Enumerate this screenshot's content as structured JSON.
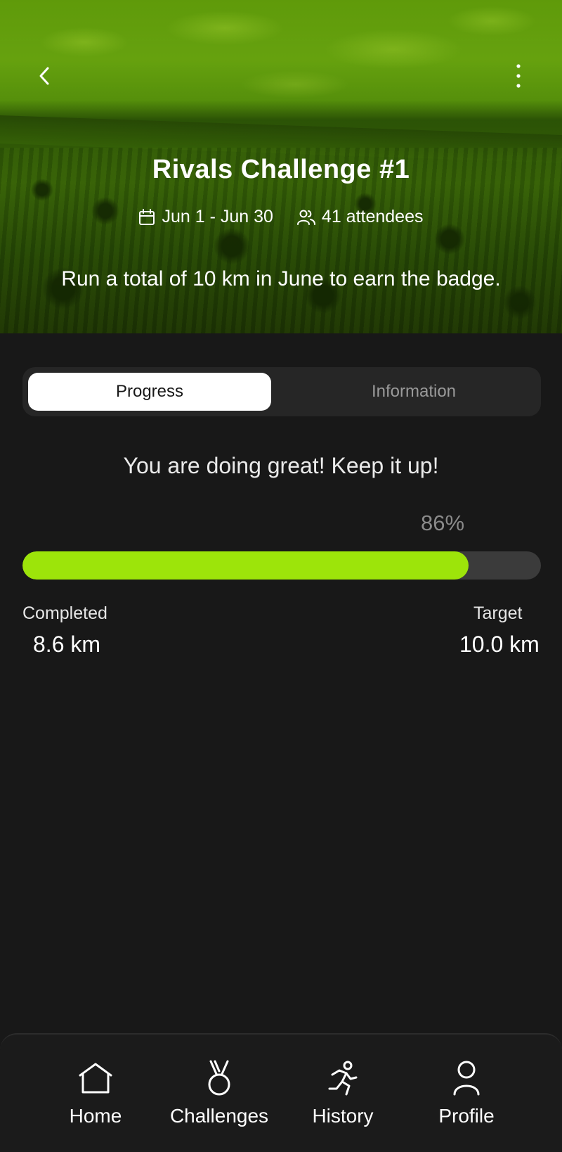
{
  "header": {
    "title": "Rivals Challenge #1",
    "dates": "Jun 1 - Jun 30",
    "attendees": "41 attendees",
    "description": "Run a total of 10 km in June to earn the badge."
  },
  "tabs": [
    {
      "label": "Progress",
      "active": true
    },
    {
      "label": "Information",
      "active": false
    }
  ],
  "progress": {
    "message": "You are doing great! Keep it up!",
    "percent_label": "86%",
    "fraction": 0.86,
    "completed_label": "Completed",
    "completed_value": "8.6 km",
    "target_label": "Target",
    "target_value": "10.0 km"
  },
  "nav": [
    {
      "label": "Home",
      "icon": "home-icon"
    },
    {
      "label": "Challenges",
      "icon": "medal-icon"
    },
    {
      "label": "History",
      "icon": "runner-icon"
    },
    {
      "label": "Profile",
      "icon": "user-icon"
    }
  ],
  "colors": {
    "accent": "#9de40a",
    "background": "#181818",
    "track": "#3b3b3b"
  }
}
